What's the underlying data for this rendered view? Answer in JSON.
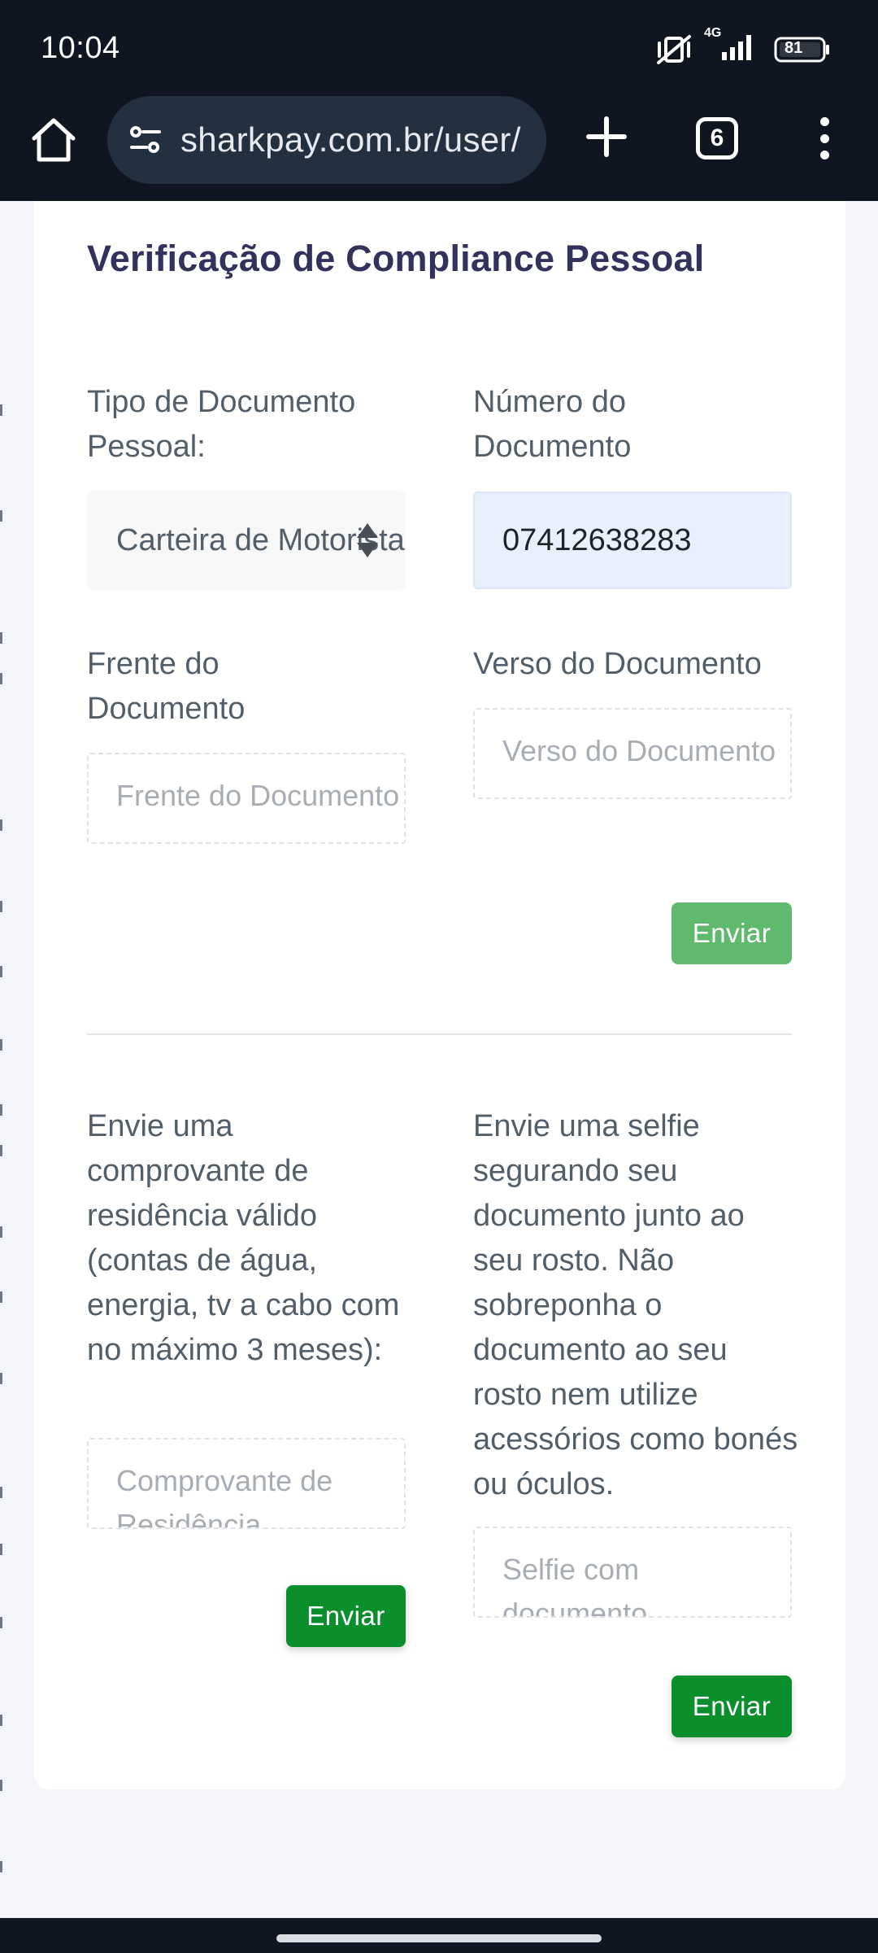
{
  "status_bar": {
    "time": "10:04",
    "network": "4G",
    "battery": "81"
  },
  "browser": {
    "url": "sharkpay.com.br/user/",
    "tab_count": "6",
    "icons": [
      "home-icon",
      "site-settings-icon",
      "plus-icon",
      "tab-switcher-icon",
      "more-vert-icon"
    ]
  },
  "page": {
    "title": "Verificação de Compliance Pessoal",
    "document_type": {
      "label": "Tipo de Documento Pessoal:",
      "selected": "Carteira de Motorista"
    },
    "document_number": {
      "label": "Número do Documento",
      "value": "07412638283"
    },
    "front": {
      "label": "Frente do Documento",
      "placeholder": "Frente do Documento"
    },
    "back": {
      "label": "Verso do Documento",
      "placeholder": "Verso do Documento"
    },
    "submit_documents": "Enviar",
    "residence": {
      "label": "Envie uma comprovante de residência válido (contas de água, energia, tv a cabo com no máximo 3 meses):",
      "placeholder": "Comprovante de Residência",
      "submit": "Enviar"
    },
    "selfie": {
      "label": "Envie uma selfie segurando seu documento junto ao seu rosto. Não sobreponha o documento ao seu rosto nem utilize acessórios como bonés ou óculos.",
      "placeholder": "Selfie com documento",
      "submit": "Enviar"
    }
  },
  "colors": {
    "title": "#32325d",
    "button_disabled": "#5fba6e",
    "button_active": "#0a8f2c",
    "input_filled": "#e8f0fe"
  }
}
